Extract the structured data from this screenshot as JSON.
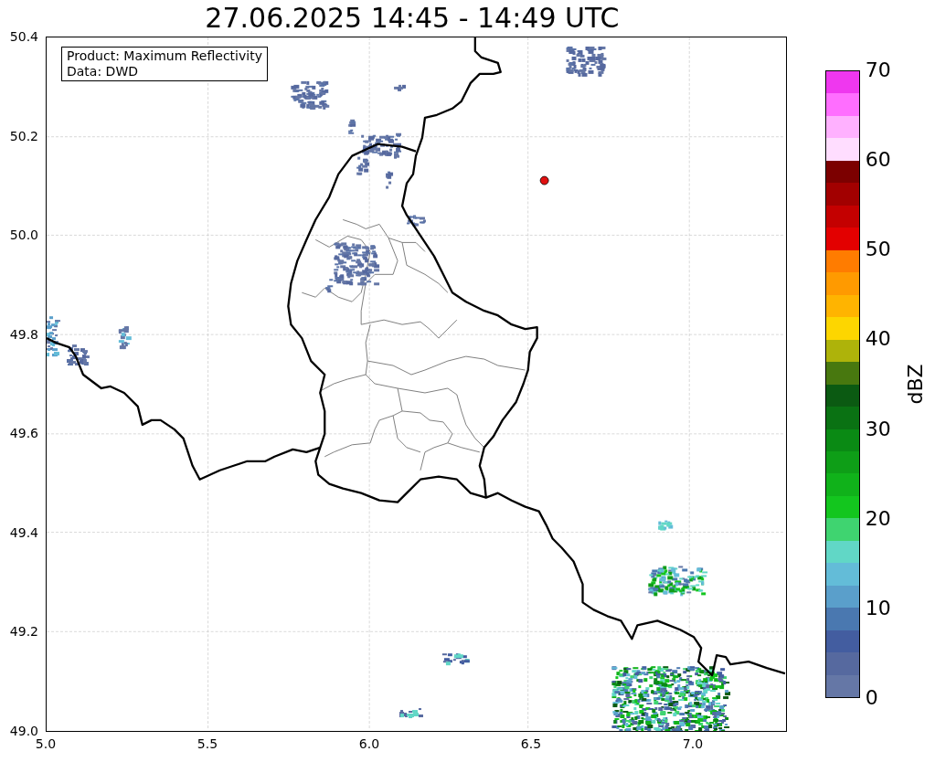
{
  "title": "27.06.2025 14:45 - 14:49 UTC",
  "info_box": [
    "Product: Maximum Reflectivity",
    "Data: DWD"
  ],
  "map": {
    "xticks": [
      "5.0",
      "5.5",
      "6.0",
      "6.5",
      "7.0"
    ],
    "yticks": [
      "50.4",
      "50.2",
      "50.0",
      "49.8",
      "49.6",
      "49.4",
      "49.2",
      "49.0"
    ]
  },
  "colorbar": {
    "label": "dBZ",
    "ticks": [
      "70",
      "60",
      "50",
      "40",
      "30",
      "20",
      "10",
      "0"
    ],
    "colors": [
      {
        "color": "#6577a6"
      },
      {
        "color": "#56699f"
      },
      {
        "color": "#435da0"
      },
      {
        "color": "#4a78b0"
      },
      {
        "color": "#5a9fcb"
      },
      {
        "color": "#63bcd8"
      },
      {
        "color": "#61d7c6"
      },
      {
        "color": "#3fd470"
      },
      {
        "color": "#13c61e"
      },
      {
        "color": "#10b21a"
      },
      {
        "color": "#0e9e17"
      },
      {
        "color": "#0a8a14"
      },
      {
        "color": "#0a7213"
      },
      {
        "color": "#0b5a12"
      },
      {
        "color": "#48780f"
      },
      {
        "color": "#aeb30a"
      },
      {
        "color": "#fdd600"
      },
      {
        "color": "#ffb400"
      },
      {
        "color": "#ff9a00"
      },
      {
        "color": "#ff7c00"
      },
      {
        "color": "#e30000"
      },
      {
        "color": "#c40000"
      },
      {
        "color": "#a20000"
      },
      {
        "color": "#7c0000"
      },
      {
        "color": "#ffddff"
      },
      {
        "color": "#ffb1ff"
      },
      {
        "color": "#ff6eff"
      },
      {
        "color": "#ef37ef"
      }
    ]
  }
}
